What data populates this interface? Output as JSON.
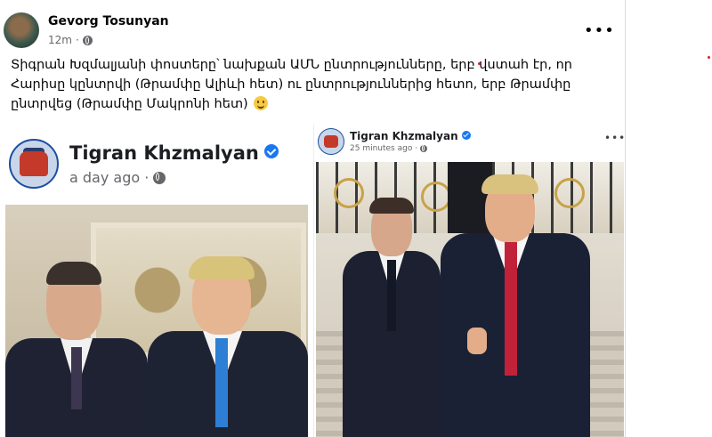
{
  "post": {
    "author": "Gevorg Tosunyan",
    "time": "12m",
    "more_icon": "more-horizontal-icon",
    "text": "Տիգրան Խզմալյանի փոստերը՝ նախքան ԱՄՆ ընտրությունները, երբ վստահ էր, որ Հարիսը կընտրվի (Թրամփը Ալիևի հետ) ու ընտրություններից հետո, երբ Թրամփը ընտրվեց (Թրամփը Մակրոնի հետ)"
  },
  "left_screenshot": {
    "name": "Tigran Khzmalyan",
    "time": "a day ago ·",
    "verified_icon": "verified-badge-icon"
  },
  "right_screenshot": {
    "name": "Tigran Khzmalyan",
    "time": "25 minutes ago ·",
    "verified_icon": "verified-badge-icon"
  },
  "colors": {
    "text_primary": "#050505",
    "text_secondary": "#65676b",
    "verified_blue": "#1877f2"
  }
}
